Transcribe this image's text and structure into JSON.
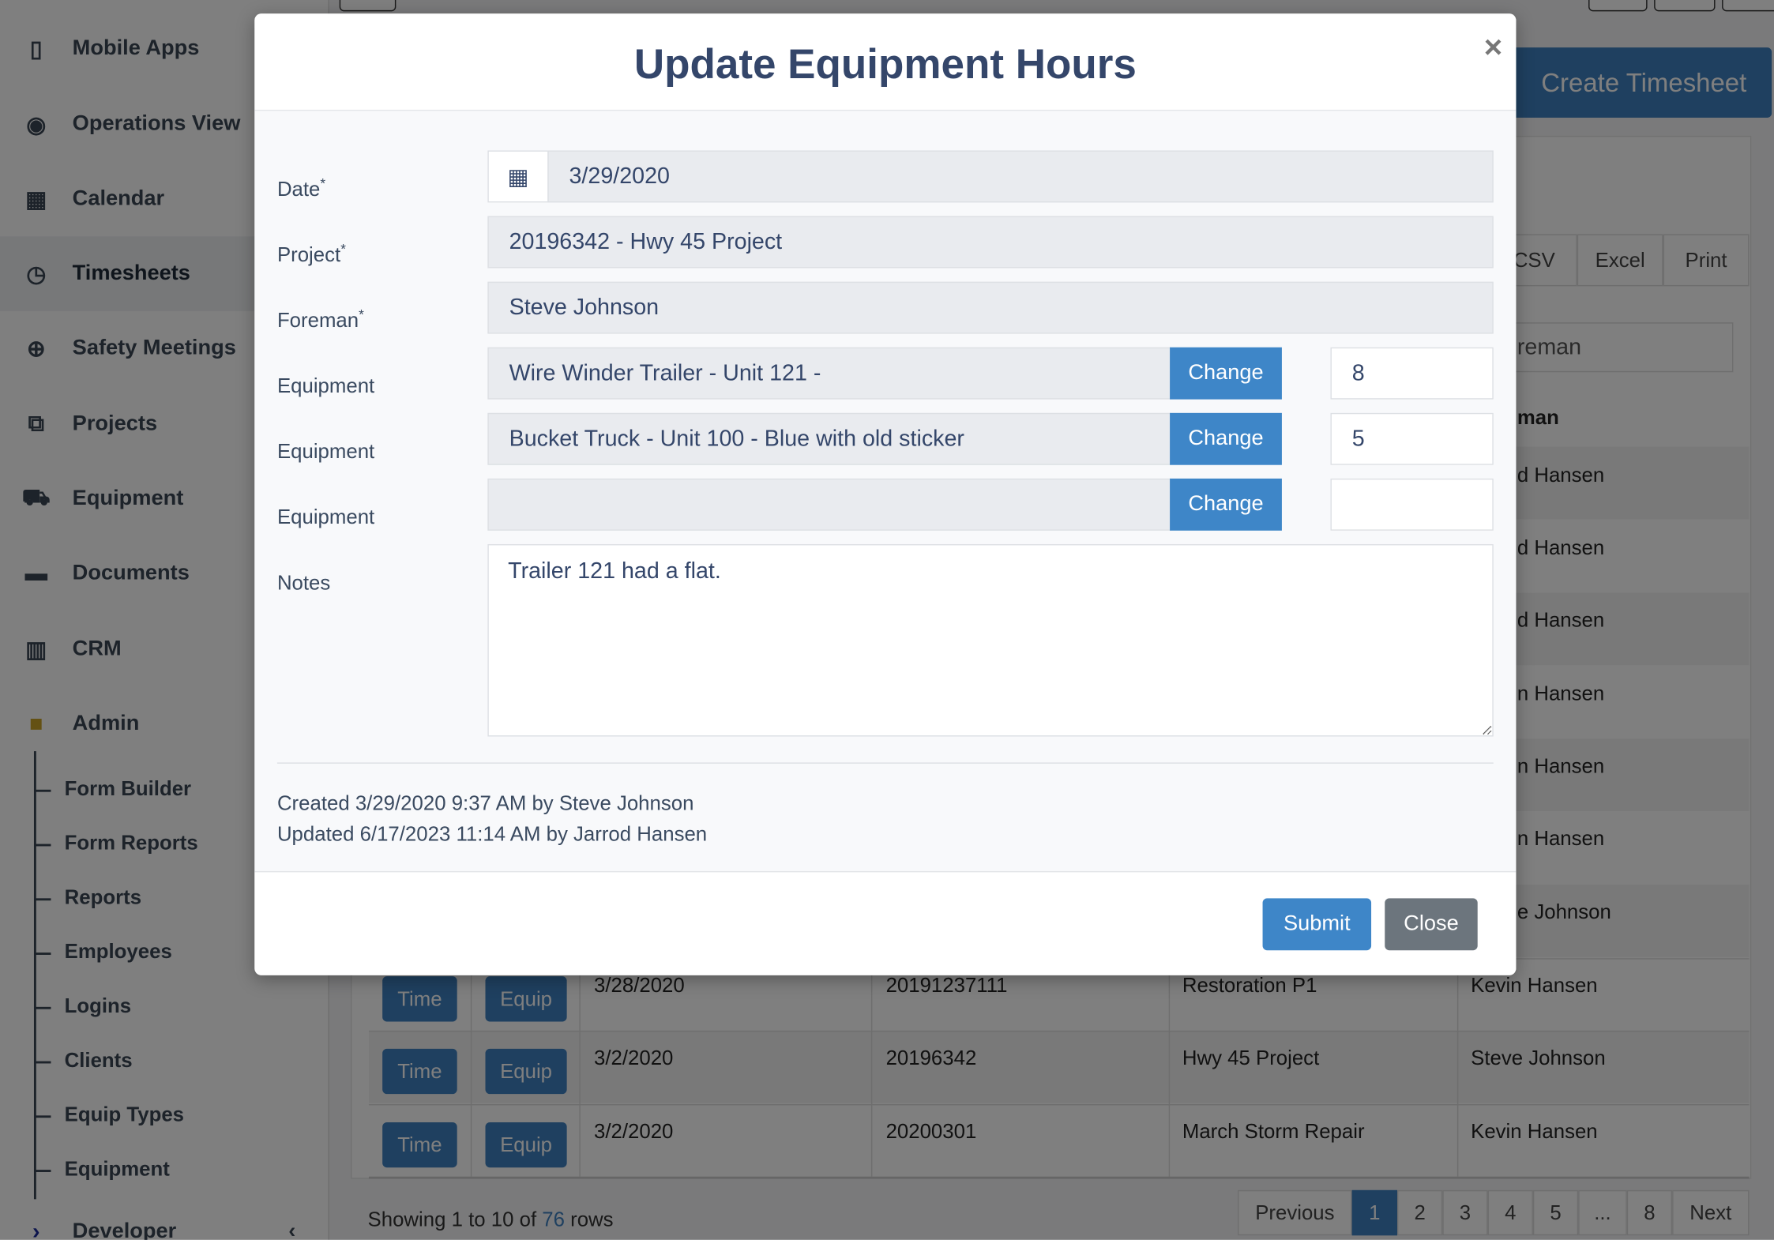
{
  "sidebar": {
    "items": [
      {
        "label": "Mobile Apps",
        "icon": "mobile-icon"
      },
      {
        "label": "Operations View",
        "icon": "eye-icon"
      },
      {
        "label": "Calendar",
        "icon": "calendar-icon"
      },
      {
        "label": "Timesheets",
        "icon": "clock-icon",
        "active": true
      },
      {
        "label": "Safety Meetings",
        "icon": "lifebuoy-icon"
      },
      {
        "label": "Projects",
        "icon": "cubes-icon"
      },
      {
        "label": "Equipment",
        "icon": "truck-icon"
      },
      {
        "label": "Documents",
        "icon": "folder-icon"
      },
      {
        "label": "CRM",
        "icon": "building-icon"
      },
      {
        "label": "Admin",
        "icon": "lock-icon"
      }
    ],
    "admin_sub": [
      "Form Builder",
      "Form Reports",
      "Reports",
      "Employees",
      "Logins",
      "Clients",
      "Equip Types",
      "Equipment"
    ],
    "developer": "Developer"
  },
  "main": {
    "create_button": "Create Timesheet",
    "export": [
      "CSV",
      "Excel",
      "Print"
    ],
    "search_placeholder_visible": "reman",
    "foreman_header_visible": "man",
    "hidden_foreman_fragments": [
      "d Hansen",
      "d Hansen",
      "d Hansen",
      "n Hansen",
      "n Hansen",
      "n Hansen",
      "e Johnson"
    ],
    "rows": [
      {
        "time": "Time",
        "equip": "Equip",
        "date": "3/28/2020",
        "number": "20191237111",
        "project": "Restoration P1",
        "foreman": "Kevin Hansen"
      },
      {
        "time": "Time",
        "equip": "Equip",
        "date": "3/2/2020",
        "number": "20196342",
        "project": "Hwy 45 Project",
        "foreman": "Steve Johnson"
      },
      {
        "time": "Time",
        "equip": "Equip",
        "date": "3/2/2020",
        "number": "20200301",
        "project": "March Storm Repair",
        "foreman": "Kevin Hansen"
      }
    ],
    "showing_prefix": "Showing 1 to 10 of ",
    "showing_total": "76",
    "showing_suffix": " rows",
    "pagination": [
      "Previous",
      "1",
      "2",
      "3",
      "4",
      "5",
      "...",
      "8",
      "Next"
    ],
    "current_page": "1"
  },
  "modal": {
    "title": "Update Equipment Hours",
    "close_icon": "×",
    "labels": {
      "date": "Date",
      "project": "Project",
      "foreman": "Foreman",
      "equipment": "Equipment",
      "notes": "Notes",
      "required": "*"
    },
    "date": "3/29/2020",
    "project": "20196342 - Hwy 45 Project",
    "foreman": "Steve Johnson",
    "equipment": [
      {
        "name": "Wire Winder Trailer - Unit 121 -",
        "hours": "8"
      },
      {
        "name": "Bucket Truck - Unit 100 - Blue with old sticker",
        "hours": "5"
      },
      {
        "name": "",
        "hours": ""
      }
    ],
    "change_label": "Change",
    "notes": "Trailer 121 had a flat.",
    "created": "Created 3/29/2020 9:37 AM by Steve Johnson",
    "updated": "Updated 6/17/2023 11:14 AM by Jarrod Hansen",
    "submit": "Submit",
    "close": "Close"
  },
  "colors": {
    "primary": "#3e86c8",
    "dark_primary": "#3e80c0",
    "secondary": "#6c757d",
    "title": "#34466a",
    "admin_lock": "#c9a227"
  }
}
